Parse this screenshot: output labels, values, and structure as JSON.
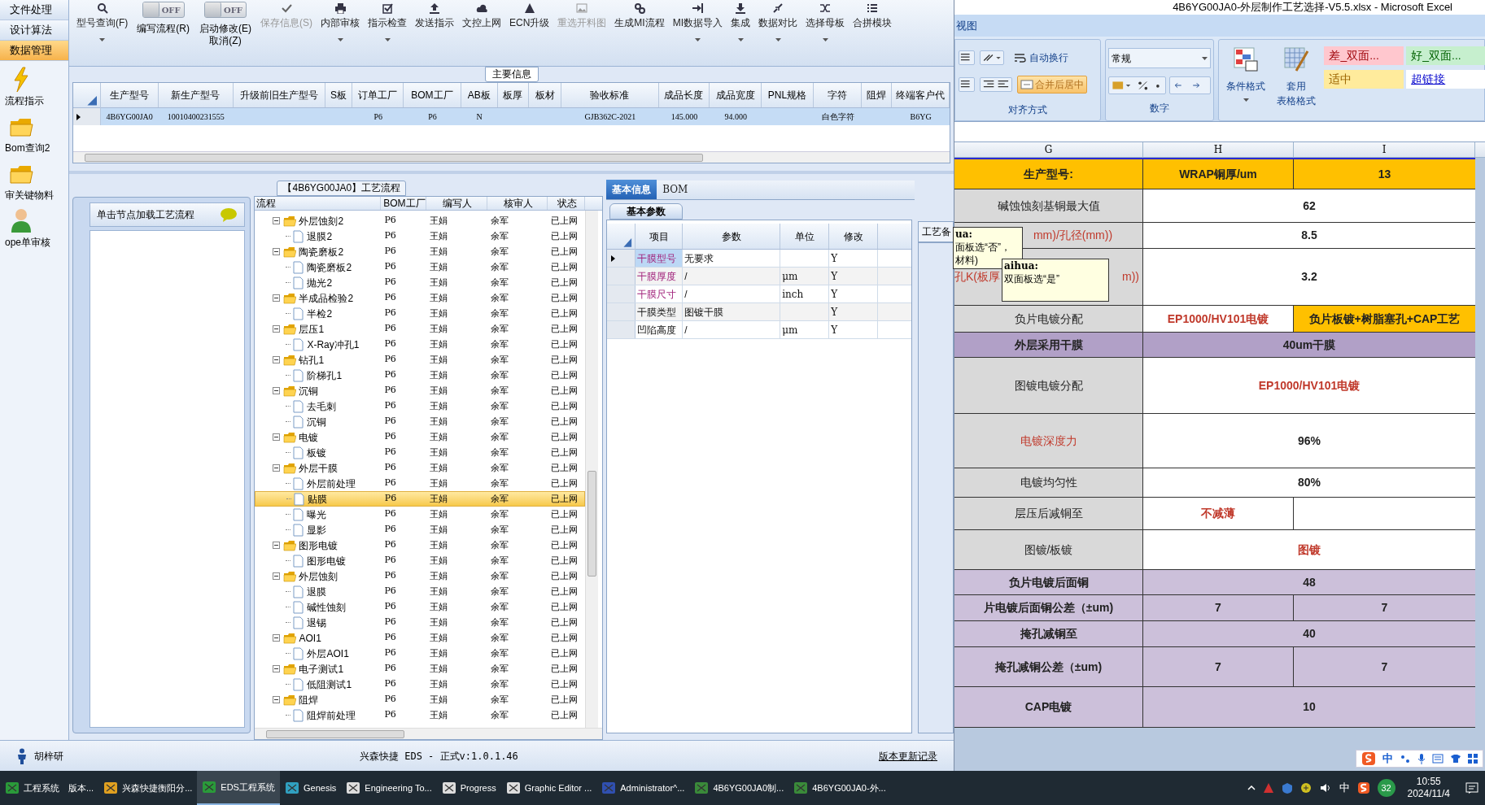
{
  "nav": {
    "menus": [
      {
        "label": "文件处理",
        "selected": false
      },
      {
        "label": "设计算法",
        "selected": false
      },
      {
        "label": "数据管理",
        "selected": true
      }
    ],
    "tools": [
      {
        "label": "流程指示"
      },
      {
        "label": "Bom查询2"
      },
      {
        "label": "审关键物料"
      },
      {
        "label": "ope单审核"
      }
    ]
  },
  "toolbar": [
    {
      "kind": "button",
      "label": "型号查询(F)",
      "dropdown": true,
      "disabled": false
    },
    {
      "kind": "toggle",
      "label": "编写流程(R)",
      "state_label": "OFF",
      "on": false
    },
    {
      "kind": "toggle",
      "label": "启动修改(E)",
      "label2": "取消(Z)",
      "state_label": "OFF",
      "on": false
    },
    {
      "kind": "button",
      "label": "保存信息(S)",
      "dropdown": false,
      "disabled": true
    },
    {
      "kind": "button",
      "label": "内部审核",
      "dropdown": true,
      "disabled": false
    },
    {
      "kind": "button",
      "label": "指示检查",
      "dropdown": true,
      "disabled": false
    },
    {
      "kind": "button",
      "label": "发送指示",
      "dropdown": false,
      "disabled": false
    },
    {
      "kind": "button",
      "label": "文控上网",
      "dropdown": false,
      "disabled": false
    },
    {
      "kind": "button",
      "label": "ECN升级",
      "dropdown": false,
      "disabled": false
    },
    {
      "kind": "button",
      "label": "重选开料图",
      "dropdown": false,
      "disabled": true
    },
    {
      "kind": "button",
      "label": "生成MI流程",
      "dropdown": false,
      "disabled": false
    },
    {
      "kind": "button",
      "label": "MI数据导入",
      "dropdown": true,
      "disabled": false
    },
    {
      "kind": "button",
      "label": "集成",
      "dropdown": true,
      "disabled": false
    },
    {
      "kind": "button",
      "label": "数据对比",
      "dropdown": true,
      "disabled": false
    },
    {
      "kind": "button",
      "label": "选择母板",
      "dropdown": true,
      "disabled": false
    },
    {
      "kind": "button",
      "label": "合拼模块",
      "dropdown": false,
      "disabled": false
    }
  ],
  "main_info": {
    "title": "主要信息",
    "columns": [
      "生产型号",
      "新生产型号",
      "升级前旧生产型号",
      "S板",
      "订单工厂",
      "BOM工厂",
      "AB板",
      "板厚",
      "板材",
      "验收标准",
      "成品长度",
      "成品宽度",
      "PNL规格",
      "字符",
      "阻焊",
      "终端客户代"
    ],
    "rows": [
      {
        "selected": true,
        "cells": [
          "4B6YG00JA0",
          "10010400231555",
          null,
          null,
          "P6",
          "P6",
          "N",
          null,
          null,
          "GJB362C-2021",
          "145.000",
          "94.000",
          null,
          "白色字符",
          null,
          "B6YG"
        ]
      }
    ]
  },
  "side_panel": {
    "hint": "单击节点加载工艺流程"
  },
  "flow": {
    "title": "【4B6YG00JA0】工艺流程",
    "columns": [
      "流程",
      "BOM工厂",
      "编写人",
      "核审人",
      "状态"
    ],
    "nodes": [
      {
        "name": "外层蚀刻2",
        "factory": "P6",
        "writer": "王娟",
        "reviewer": "余军",
        "status": "已上网",
        "expanded": true,
        "selected": false,
        "children": [
          {
            "name": "退膜2",
            "factory": "P6",
            "writer": "王娟",
            "reviewer": "余军",
            "status": "已上网",
            "selected": false
          }
        ]
      },
      {
        "name": "陶瓷磨板2",
        "factory": "P6",
        "writer": "王娟",
        "reviewer": "余军",
        "status": "已上网",
        "expanded": true,
        "selected": false,
        "children": [
          {
            "name": "陶瓷磨板2",
            "factory": "P6",
            "writer": "王娟",
            "reviewer": "余军",
            "status": "已上网",
            "selected": false
          },
          {
            "name": "抛光2",
            "factory": "P6",
            "writer": "王娟",
            "reviewer": "余军",
            "status": "已上网",
            "selected": false
          }
        ]
      },
      {
        "name": "半成品检验2",
        "factory": "P6",
        "writer": "王娟",
        "reviewer": "余军",
        "status": "已上网",
        "expanded": true,
        "selected": false,
        "children": [
          {
            "name": "半检2",
            "factory": "P6",
            "writer": "王娟",
            "reviewer": "余军",
            "status": "已上网",
            "selected": false
          }
        ]
      },
      {
        "name": "层压1",
        "factory": "P6",
        "writer": "王娟",
        "reviewer": "余军",
        "status": "已上网",
        "expanded": true,
        "selected": false,
        "children": [
          {
            "name": "X-Ray冲孔1",
            "factory": "P6",
            "writer": "王娟",
            "reviewer": "余军",
            "status": "已上网",
            "selected": false
          }
        ]
      },
      {
        "name": "钻孔1",
        "factory": "P6",
        "writer": "王娟",
        "reviewer": "余军",
        "status": "已上网",
        "expanded": true,
        "selected": false,
        "children": [
          {
            "name": "阶梯孔1",
            "factory": "P6",
            "writer": "王娟",
            "reviewer": "余军",
            "status": "已上网",
            "selected": false
          }
        ]
      },
      {
        "name": "沉铜",
        "factory": "P6",
        "writer": "王娟",
        "reviewer": "余军",
        "status": "已上网",
        "expanded": true,
        "selected": false,
        "children": [
          {
            "name": "去毛刺",
            "factory": "P6",
            "writer": "王娟",
            "reviewer": "余军",
            "status": "已上网",
            "selected": false
          },
          {
            "name": "沉铜",
            "factory": "P6",
            "writer": "王娟",
            "reviewer": "余军",
            "status": "已上网",
            "selected": false
          }
        ]
      },
      {
        "name": "电镀",
        "factory": "P6",
        "writer": "王娟",
        "reviewer": "余军",
        "status": "已上网",
        "expanded": true,
        "selected": false,
        "children": [
          {
            "name": "板镀",
            "factory": "P6",
            "writer": "王娟",
            "reviewer": "余军",
            "status": "已上网",
            "selected": false
          }
        ]
      },
      {
        "name": "外层干膜",
        "factory": "P6",
        "writer": "王娟",
        "reviewer": "余军",
        "status": "已上网",
        "expanded": true,
        "selected": false,
        "children": [
          {
            "name": "外层前处理",
            "factory": "P6",
            "writer": "王娟",
            "reviewer": "余军",
            "status": "已上网",
            "selected": false
          },
          {
            "name": "贴膜",
            "factory": "P6",
            "writer": "王娟",
            "reviewer": "余军",
            "status": "已上网",
            "selected": true
          },
          {
            "name": "曝光",
            "factory": "P6",
            "writer": "王娟",
            "reviewer": "余军",
            "status": "已上网",
            "selected": false
          },
          {
            "name": "显影",
            "factory": "P6",
            "writer": "王娟",
            "reviewer": "余军",
            "status": "已上网",
            "selected": false
          }
        ]
      },
      {
        "name": "图形电镀",
        "factory": "P6",
        "writer": "王娟",
        "reviewer": "余军",
        "status": "已上网",
        "expanded": true,
        "selected": false,
        "children": [
          {
            "name": "图形电镀",
            "factory": "P6",
            "writer": "王娟",
            "reviewer": "余军",
            "status": "已上网",
            "selected": false
          }
        ]
      },
      {
        "name": "外层蚀刻",
        "factory": "P6",
        "writer": "王娟",
        "reviewer": "余军",
        "status": "已上网",
        "expanded": true,
        "selected": false,
        "children": [
          {
            "name": "退膜",
            "factory": "P6",
            "writer": "王娟",
            "reviewer": "余军",
            "status": "已上网",
            "selected": false
          },
          {
            "name": "碱性蚀刻",
            "factory": "P6",
            "writer": "王娟",
            "reviewer": "余军",
            "status": "已上网",
            "selected": false
          },
          {
            "name": "退锡",
            "factory": "P6",
            "writer": "王娟",
            "reviewer": "余军",
            "status": "已上网",
            "selected": false
          }
        ]
      },
      {
        "name": "AOI1",
        "factory": "P6",
        "writer": "王娟",
        "reviewer": "余军",
        "status": "已上网",
        "expanded": true,
        "selected": false,
        "children": [
          {
            "name": "外层AOI1",
            "factory": "P6",
            "writer": "王娟",
            "reviewer": "余军",
            "status": "已上网",
            "selected": false
          }
        ]
      },
      {
        "name": "电子测试1",
        "factory": "P6",
        "writer": "王娟",
        "reviewer": "余军",
        "status": "已上网",
        "expanded": true,
        "selected": false,
        "children": [
          {
            "name": "低阻测试1",
            "factory": "P6",
            "writer": "王娟",
            "reviewer": "余军",
            "status": "已上网",
            "selected": false
          }
        ]
      },
      {
        "name": "阻焊",
        "factory": "P6",
        "writer": "王娟",
        "reviewer": "余军",
        "status": "已上网",
        "expanded": true,
        "selected": false,
        "children": [
          {
            "name": "阻焊前处理",
            "factory": "P6",
            "writer": "王娟",
            "reviewer": "余军",
            "status": "已上网",
            "selected": false
          }
        ]
      }
    ]
  },
  "detail": {
    "tabs": [
      {
        "label": "基本信息",
        "selected": true
      },
      {
        "label": "BOM",
        "selected": false
      }
    ],
    "subtab": "基本参数",
    "columns": [
      "项目",
      "参数",
      "单位",
      "修改"
    ],
    "rows": [
      {
        "item": "干膜型号",
        "value": "无要求",
        "unit": null,
        "modify": "Y",
        "flagged": true,
        "current": true
      },
      {
        "item": "干膜厚度",
        "value": "/",
        "unit": "μm",
        "modify": "Y",
        "flagged": true,
        "current": false
      },
      {
        "item": "干膜尺寸",
        "value": "/",
        "unit": "inch",
        "modify": "Y",
        "flagged": true,
        "current": false
      },
      {
        "item": "干膜类型",
        "value": "图镀干膜",
        "unit": null,
        "modify": "Y",
        "flagged": false,
        "current": false
      },
      {
        "item": "凹陷高度",
        "value": "/",
        "unit": "μm",
        "modify": "Y",
        "flagged": false,
        "current": false
      }
    ],
    "side_tab": "工艺备"
  },
  "status_bar": {
    "user": "胡梓研",
    "version": "兴森快捷 EDS - 正式v:1.0.1.46",
    "link": "版本更新记录"
  },
  "excel": {
    "title": "4B6YG00JA0-外层制作工艺选择-V5.5.xlsx - Microsoft Excel",
    "tab": "视图",
    "ribbon": {
      "wrap": "自动换行",
      "merge": "合并后居中",
      "align_group": "对齐方式",
      "number_format": "常规",
      "number_group": "数字",
      "conditional": "条件格式",
      "table_format1": "套用",
      "table_format2": "表格格式",
      "styles": [
        {
          "label": "差_双面...",
          "kind": "bad"
        },
        {
          "label": "好_双面...",
          "kind": "good"
        },
        {
          "label": "适中",
          "kind": "neutral"
        },
        {
          "label": "超链接",
          "kind": "link"
        }
      ]
    },
    "columns": [
      "G",
      "H",
      "I"
    ],
    "rows": [
      {
        "label": "生产型号:",
        "kind": "title",
        "label_alert": false,
        "merged": false,
        "cells": [
          {
            "text": "WRAP铜厚/um",
            "alert": false
          },
          {
            "text": "13",
            "alert": false
          }
        ]
      },
      {
        "label": "碱蚀蚀刻基铜最大值",
        "kind": "field",
        "label_alert": false,
        "merged": true,
        "cells": [
          {
            "text": "62",
            "alert": false,
            "highlighted": false
          }
        ]
      },
      {
        "label": "mm)/孔径(mm))",
        "kind": "field",
        "label_alert": true,
        "merged": true,
        "cells": [
          {
            "text": "8.5",
            "alert": false,
            "highlighted": false
          }
        ]
      },
      {
        "label": "孔K(板厚",
        "label_end": "m))",
        "kind": "field",
        "label_alert": true,
        "merged": true,
        "cells": [
          {
            "text": "3.2",
            "alert": false,
            "highlighted": false
          }
        ]
      },
      {
        "label": "负片电镀分配",
        "kind": "field",
        "label_alert": false,
        "merged": false,
        "cells": [
          {
            "text": "EP1000/HV101电镀",
            "alert": true,
            "highlighted": false
          },
          {
            "text": "负片板镀+树脂塞孔+CAP工艺",
            "alert": false,
            "highlighted": true
          }
        ]
      },
      {
        "label": "外层采用干膜",
        "kind": "section",
        "label_alert": false,
        "merged": true,
        "cells": [
          {
            "text": "40um干膜",
            "alert": false,
            "highlighted": false
          }
        ]
      },
      {
        "label": "图镀电镀分配",
        "kind": "field",
        "label_alert": false,
        "merged": true,
        "cells": [
          {
            "text": "EP1000/HV101电镀",
            "alert": true,
            "highlighted": false
          }
        ]
      },
      {
        "label": "电镀深度力",
        "kind": "field",
        "label_alert": true,
        "merged": true,
        "cells": [
          {
            "text": "96%",
            "alert": false,
            "highlighted": false
          }
        ]
      },
      {
        "label": "电镀均匀性",
        "kind": "field",
        "label_alert": false,
        "merged": true,
        "cells": [
          {
            "text": "80%",
            "alert": false,
            "highlighted": false
          }
        ]
      },
      {
        "label": "层压后减铜至",
        "kind": "field",
        "label_alert": false,
        "merged": false,
        "cells": [
          {
            "text": "不减薄",
            "alert": true,
            "highlighted": false
          }
        ]
      },
      {
        "label": "图镀/板镀",
        "kind": "field",
        "label_alert": false,
        "merged": true,
        "cells": [
          {
            "text": "图镀",
            "alert": true,
            "highlighted": false
          }
        ]
      },
      {
        "label": "负片电镀后面铜",
        "kind": "summary",
        "label_alert": false,
        "merged": true,
        "cells": [
          {
            "text": "48",
            "alert": false,
            "highlighted": false
          }
        ]
      },
      {
        "label": "片电镀后面铜公差（±um)",
        "kind": "summary",
        "label_alert": false,
        "merged": false,
        "cells": [
          {
            "text": "7",
            "alert": false,
            "highlighted": false
          },
          {
            "text": "7",
            "alert": false,
            "highlighted": false
          }
        ]
      },
      {
        "label": "掩孔减铜至",
        "kind": "summary",
        "label_alert": false,
        "merged": true,
        "cells": [
          {
            "text": "40",
            "alert": false,
            "highlighted": false
          }
        ]
      },
      {
        "label": "掩孔减铜公差（±um)",
        "kind": "summary",
        "label_alert": false,
        "merged": false,
        "cells": [
          {
            "text": "7",
            "alert": false,
            "highlighted": false
          },
          {
            "text": "7",
            "alert": false,
            "highlighted": false
          }
        ]
      },
      {
        "label": "CAP电镀",
        "kind": "summary",
        "label_alert": false,
        "merged": true,
        "cells": [
          {
            "text": "10",
            "alert": false,
            "highlighted": false
          }
        ]
      }
    ],
    "comments": [
      {
        "lines": [
          "ua:",
          "面板选“否”，",
          "材料)"
        ]
      },
      {
        "lines": [
          "aihua:",
          "双面板选“是”"
        ]
      }
    ],
    "ime": "中"
  },
  "taskbar": {
    "items": [
      {
        "label": "工程系统　版本...",
        "selected": false
      },
      {
        "label": "兴森快捷衡阳分...",
        "selected": false
      },
      {
        "label": "EDS工程系统",
        "selected": true
      },
      {
        "label": "Genesis",
        "selected": false
      },
      {
        "label": "Engineering To...",
        "selected": false
      },
      {
        "label": "Progress",
        "selected": false
      },
      {
        "label": "Graphic Editor ...",
        "selected": false
      },
      {
        "label": "Administrator^...",
        "selected": false
      },
      {
        "label": "4B6YG00JA0制...",
        "selected": false
      },
      {
        "label": "4B6YG00JA0-外...",
        "selected": false
      }
    ],
    "ime": "中",
    "badge": "32",
    "time": "10:55",
    "date": "2024/11/4"
  }
}
